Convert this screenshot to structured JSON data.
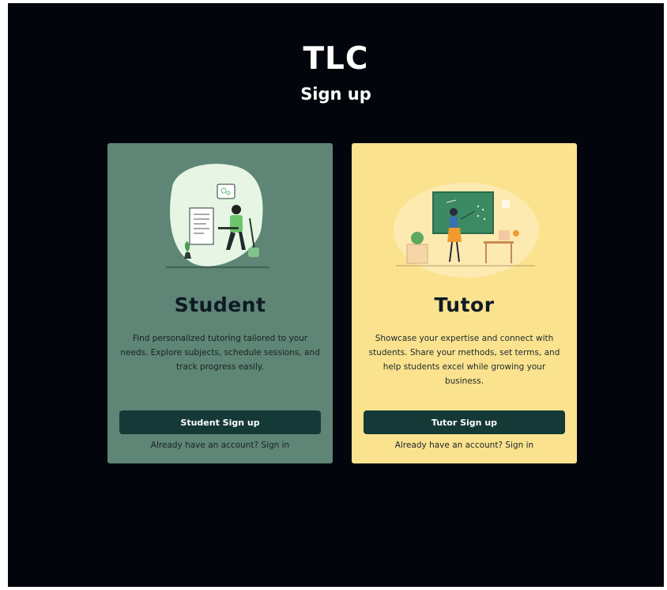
{
  "app": {
    "brand": "TLC",
    "heading": "Sign up"
  },
  "cards": [
    {
      "title": "Student",
      "description": "Find personalized tutoring tailored to your needs. Explore subjects, schedule sessions, and track progress easily.",
      "button_label": "Student Sign up",
      "signin_prompt": "Already have an account?",
      "signin_link": "Sign in",
      "background": "#5e8575"
    },
    {
      "title": "Tutor",
      "description": "Showcase your expertise and connect with students. Share your methods, set terms, and help students excel while growing your business.",
      "button_label": "Tutor Sign up",
      "signin_prompt": "Already have an account?",
      "signin_link": "Sign in",
      "background": "#fbe28f"
    }
  ],
  "colors": {
    "page_bg": "#02060c",
    "button_bg": "#143937",
    "text_dark": "#0f1a24"
  }
}
